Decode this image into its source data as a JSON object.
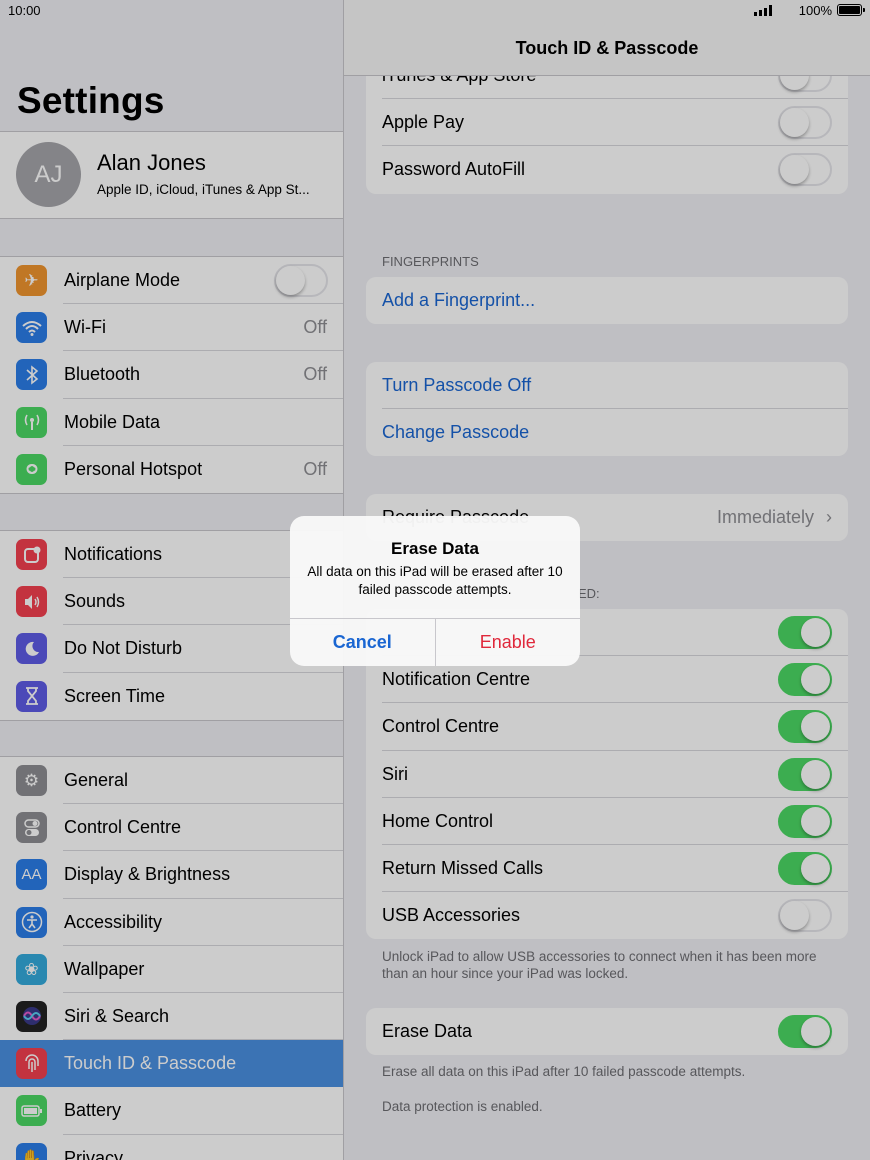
{
  "status": {
    "time": "10:00",
    "battery": "100%"
  },
  "sidebar": {
    "title": "Settings",
    "profile": {
      "initials": "AJ",
      "name": "Alan Jones",
      "subtitle": "Apple ID, iCloud, iTunes & App St..."
    },
    "group1": [
      {
        "label": "Airplane Mode",
        "icon": "airplane-icon",
        "color": "#f0952f",
        "toggle": false
      },
      {
        "label": "Wi-Fi",
        "icon": "wifi-icon",
        "color": "#2b7de9",
        "value": "Off"
      },
      {
        "label": "Bluetooth",
        "icon": "bluetooth-icon",
        "color": "#2b7de9",
        "value": "Off"
      },
      {
        "label": "Mobile Data",
        "icon": "antenna-icon",
        "color": "#4cd964"
      },
      {
        "label": "Personal Hotspot",
        "icon": "hotspot-icon",
        "color": "#4cd964",
        "value": "Off"
      }
    ],
    "group2": [
      {
        "label": "Notifications",
        "icon": "notifications-icon",
        "color": "#f4404f"
      },
      {
        "label": "Sounds",
        "icon": "speaker-icon",
        "color": "#f4404f"
      },
      {
        "label": "Do Not Disturb",
        "icon": "moon-icon",
        "color": "#5e5ce6"
      },
      {
        "label": "Screen Time",
        "icon": "hourglass-icon",
        "color": "#5e5ce6"
      }
    ],
    "group3": [
      {
        "label": "General",
        "icon": "gear-icon",
        "color": "#8e8e93"
      },
      {
        "label": "Control Centre",
        "icon": "switches-icon",
        "color": "#8e8e93"
      },
      {
        "label": "Display & Brightness",
        "icon": "text-size-icon",
        "color": "#2b7de9"
      },
      {
        "label": "Accessibility",
        "icon": "accessibility-icon",
        "color": "#2b7de9"
      },
      {
        "label": "Wallpaper",
        "icon": "flower-icon",
        "color": "#34aadc"
      },
      {
        "label": "Siri & Search",
        "icon": "siri-icon",
        "color": "#222222"
      },
      {
        "label": "Touch ID & Passcode",
        "icon": "fingerprint-icon",
        "color": "#f4404f"
      },
      {
        "label": "Battery",
        "icon": "battery-icon",
        "color": "#4cd964"
      },
      {
        "label": "Privacy",
        "icon": "hand-icon",
        "color": "#2b7de9"
      }
    ]
  },
  "detail": {
    "nav_title": "Touch ID & Passcode",
    "top_rows": [
      {
        "label": "iTunes & App Store",
        "toggle": false
      },
      {
        "label": "Apple Pay",
        "toggle": false
      },
      {
        "label": "Password AutoFill",
        "toggle": false
      }
    ],
    "fingerprints_header": "FINGERPRINTS",
    "add_fingerprint": "Add a Fingerprint...",
    "turn_off": "Turn Passcode Off",
    "change": "Change Passcode",
    "require_label": "Require Passcode",
    "require_value": "Immediately",
    "allow_header_visible": "ED:",
    "allow_rows": [
      {
        "label": "",
        "toggle": true
      },
      {
        "label": "Notification Centre",
        "toggle": true
      },
      {
        "label": "Control Centre",
        "toggle": true
      },
      {
        "label": "Siri",
        "toggle": true
      },
      {
        "label": "Home Control",
        "toggle": true
      },
      {
        "label": "Return Missed Calls",
        "toggle": true
      },
      {
        "label": "USB Accessories",
        "toggle": false
      }
    ],
    "usb_note": "Unlock iPad to allow USB accessories to connect when it has been more than an hour since your iPad was locked.",
    "erase_label": "Erase Data",
    "erase_toggle": true,
    "erase_note": "Erase all data on this iPad after 10 failed passcode attempts.",
    "protection_note": "Data protection is enabled."
  },
  "alert": {
    "title": "Erase Data",
    "message": "All data on this iPad will be erased after 10 failed passcode attempts.",
    "cancel": "Cancel",
    "enable": "Enable"
  }
}
